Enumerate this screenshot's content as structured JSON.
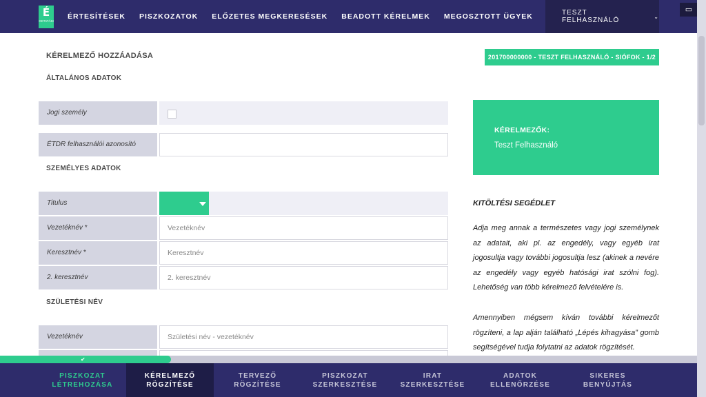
{
  "header": {
    "logo_letter": "É",
    "logo_sub": "OKTATÁSI",
    "nav": [
      "ÉRTESÍTÉSEK",
      "PISZKOZATOK",
      "ELŐZETES MEGKERESÉSEK",
      "BEADOTT KÉRELMEK",
      "MEGOSZTOTT ÜGYEK"
    ],
    "user": "TESZT FELHASZNÁLÓ",
    "user_chevron_icon": "chevron-down-icon",
    "screen_icon": "monitor-icon"
  },
  "page": {
    "title": "KÉRELMEZŐ HOZZÁADÁSA",
    "case_badge": "201700000000 - TESZT FELHASZNÁLÓ - SIÓFOK - 1/2",
    "section_general": "ÁLTALÁNOS ADATOK",
    "section_personal": "SZEMÉLYES ADATOK",
    "section_birth": "SZÜLETÉSI NÉV"
  },
  "form": {
    "legal_person": {
      "label": "Jogi személy",
      "checked": false
    },
    "etdr_id": {
      "label": "ÉTDR felhasználói azonosító",
      "value": ""
    },
    "title": {
      "label": "Titulus",
      "value": ""
    },
    "surname": {
      "label": "Vezetéknév",
      "required": "*",
      "placeholder": "Vezetéknév"
    },
    "firstname": {
      "label": "Keresztnév",
      "required": "*",
      "placeholder": "Keresztnév"
    },
    "second_firstname": {
      "label": "2. keresztnév",
      "placeholder": "2. keresztnév"
    },
    "birth_surname": {
      "label": "Vezetéknév",
      "placeholder": "Születési név - vezetéknév"
    }
  },
  "sidebar": {
    "applicants_title": "KÉRELMEZŐK:",
    "applicants_name": "Teszt Felhasználó",
    "help_title": "KITÖLTÉSI SEGÉDLET",
    "help_p1": "Adja meg annak a természetes vagy jogi személynek az adatait, aki pl. az engedély, vagy egyéb irat jogosultja vagy további jogosultja lesz (akinek a nevére az engedély vagy egyéb hatósági irat szólni fog). Lehetőség van több kérelmező felvételére is.",
    "help_p2": "Amennyiben mégsem kíván további kérelmezőt rögzíteni, a lap alján található „Lépés kihagyása” gomb segítségével tudja folytatni az adatok rögzítését."
  },
  "progress": {
    "fraction": 0.245,
    "check_icon": "check-icon"
  },
  "steps": [
    {
      "l1": "PISZKOZAT",
      "l2": "LÉTREHOZÁSA",
      "state": "done"
    },
    {
      "l1": "KÉRELMEZŐ",
      "l2": "RÖGZÍTÉSE",
      "state": "active"
    },
    {
      "l1": "TERVEZŐ",
      "l2": "RÖGZÍTÉSE",
      "state": "todo"
    },
    {
      "l1": "PISZKOZAT",
      "l2": "SZERKESZTÉSE",
      "state": "todo"
    },
    {
      "l1": "IRAT",
      "l2": "SZERKESZTÉSE",
      "state": "todo"
    },
    {
      "l1": "ADATOK",
      "l2": "ELLENŐRZÉSE",
      "state": "todo"
    },
    {
      "l1": "SIKERES",
      "l2": "BENYÚJTÁS",
      "state": "todo"
    }
  ],
  "colors": {
    "navy": "#2e2c6b",
    "accent": "#2ecc8e",
    "label_bg": "#d4d5e1"
  }
}
